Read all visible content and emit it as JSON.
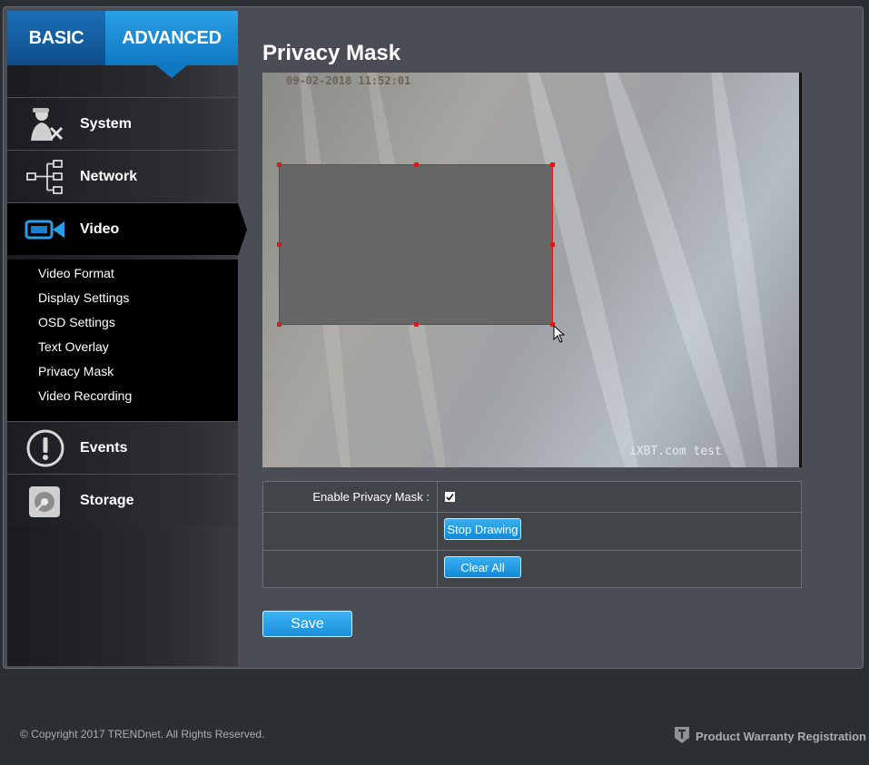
{
  "sidebar": {
    "modes": {
      "basic": "BASIC",
      "advanced": "ADVANCED"
    },
    "items": [
      {
        "label": "System",
        "icon": "system-tools-icon"
      },
      {
        "label": "Network",
        "icon": "network-tree-icon"
      },
      {
        "label": "Video",
        "icon": "video-camera-icon"
      },
      {
        "label": "Events",
        "icon": "alert-icon"
      },
      {
        "label": "Storage",
        "icon": "storage-disk-icon"
      }
    ],
    "video_submenu": [
      "Video Format",
      "Display Settings",
      "OSD Settings",
      "Text Overlay",
      "Privacy Mask",
      "Video Recording"
    ]
  },
  "main": {
    "title": "Privacy Mask",
    "video": {
      "timestamp": "09-02-2018 11:52:01",
      "watermark": "iXBT.com test"
    },
    "settings": {
      "enable_label": "Enable Privacy Mask :",
      "enable_checked": true,
      "stop_drawing": "Stop Drawing",
      "clear_all": "Clear All"
    },
    "save": "Save"
  },
  "footer": {
    "copyright": "© Copyright 2017 TRENDnet. All Rights Reserved.",
    "warranty": "Product Warranty Registration"
  },
  "colors": {
    "accent": "#1188d8",
    "mask_border": "#e01818"
  }
}
